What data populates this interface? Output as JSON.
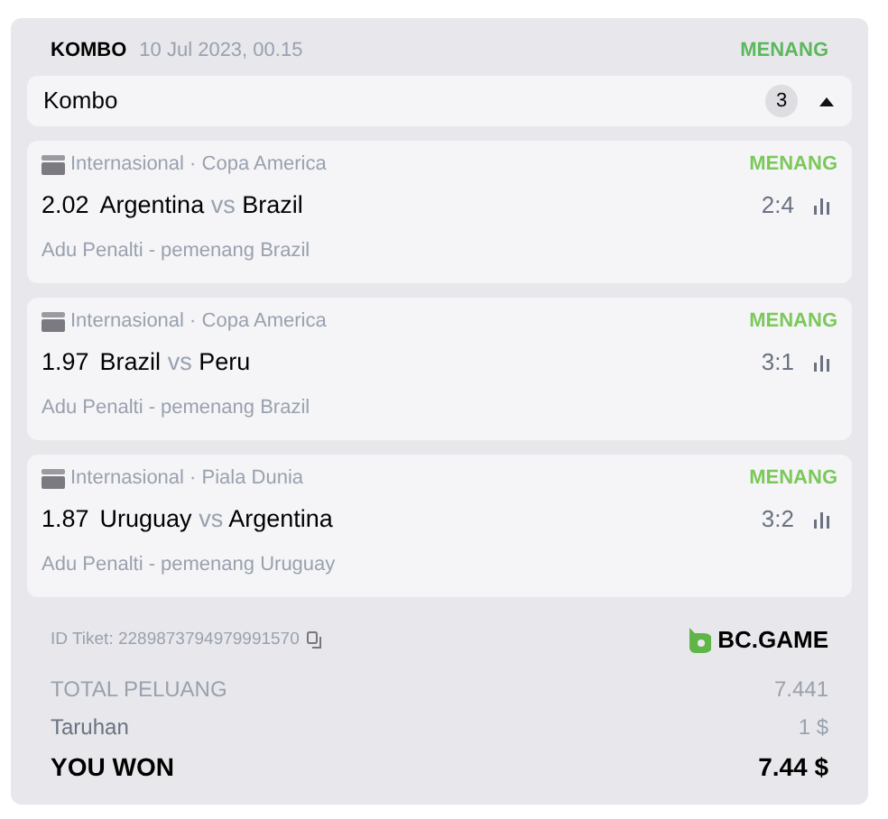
{
  "header": {
    "type": "KOMBO",
    "date": "10 Jul 2023, 00.15",
    "status": "MENANG"
  },
  "group": {
    "title": "Kombo",
    "count": "3",
    "expanded": true
  },
  "bets": [
    {
      "league": "Internasional · Copa America",
      "status": "MENANG",
      "odds": "2.02",
      "home": "Argentina",
      "vs": "vs",
      "away": "Brazil",
      "score": "2:4",
      "market": "Adu Penalti - pemenang Brazil"
    },
    {
      "league": "Internasional · Copa America",
      "status": "MENANG",
      "odds": "1.97",
      "home": "Brazil",
      "vs": "vs",
      "away": "Peru",
      "score": "3:1",
      "market": "Adu Penalti - pemenang Brazil"
    },
    {
      "league": "Internasional · Piala Dunia",
      "status": "MENANG",
      "odds": "1.87",
      "home": "Uruguay",
      "vs": "vs",
      "away": "Argentina",
      "score": "3:2",
      "market": "Adu Penalti - pemenang Uruguay"
    }
  ],
  "ticket": {
    "label": "ID Tiket: 2289873794979991570",
    "brand": "BC.GAME"
  },
  "totals": [
    {
      "kind": "muted",
      "label": "TOTAL PELUANG",
      "value": "7.441"
    },
    {
      "kind": "normal",
      "label": "Taruhan",
      "value": "1 $"
    },
    {
      "kind": "strong",
      "label": "YOU WON",
      "value": "7.44 $"
    }
  ]
}
